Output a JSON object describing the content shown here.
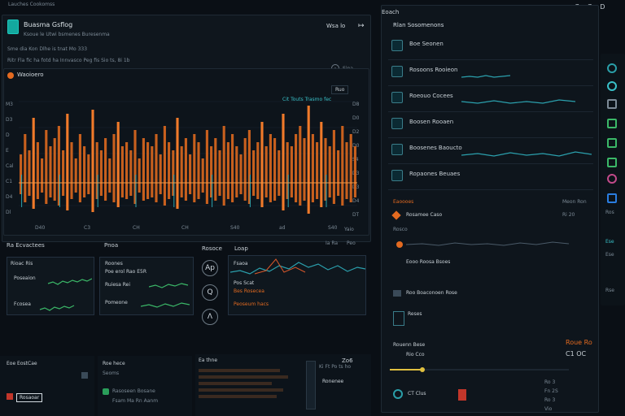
{
  "topbar": {
    "left": "Lauches Cookomss",
    "right_ctrl_a": "C",
    "right_ctrl_b": "C",
    "right_ctrl_c": "D"
  },
  "left_panel": {
    "app_title": "Buasma Gsflog",
    "app_sub": "Ksoue le Utwi bsmenes Buresenma",
    "sub_row_1": "Sme dia Kon Dlhe is tnat Mo 333",
    "sub_row_2": "Ritr Fla fic ha fotd ha Innvasco Peg fis Sio ts, 8i 1b",
    "header_right": "Wsa lo",
    "header_arrow": "↦",
    "header_menu_label": "Sina"
  },
  "waveform_panel": {
    "title": "Waoioero",
    "overlay_label": "Cit Touts Trasmo fec",
    "range_label": "Ruo",
    "x_labels": [
      "D40",
      "C3",
      "CH",
      "CH",
      "S40",
      "ad",
      "S40"
    ],
    "y_labels": [
      "M3",
      "D3",
      "D",
      "E",
      "Cal",
      "C1",
      "D4",
      "Dl"
    ],
    "right_labels": [
      "D8",
      "D0",
      "D2",
      "D0",
      "S4",
      "D3",
      "D3",
      "D4",
      "DT"
    ],
    "bottom_right": "Yaio"
  },
  "bottom_left": {
    "section_label": "Ra Ecvactees",
    "section_label_2": "Pnoa",
    "card1_title": "Rioac Ris",
    "card1_line": "Poseaion",
    "card1_line2": "Fcosea",
    "card2_title": "Roones",
    "card2_line": "Poe erol Rao E5R",
    "card2_line2": "Ruiesa Rei",
    "card2_line3": "Pomeone"
  },
  "bottom_mid": {
    "section_label": "Rosoce",
    "section_label_2": "Loap",
    "nav_a": "Ap",
    "nav_b": "Q",
    "nav_c": "Λ",
    "lines": [
      "Fsaoa",
      "Pos Scat",
      "Bes Rosecea",
      "Peoseum hacs"
    ],
    "corner": "Ia Ra",
    "corner2": "Peo"
  },
  "footer_left": {
    "title": "Eoe EostCae",
    "title_2": "Roe hece",
    "title_3": "Ea thne",
    "items": [
      "Rosaoar",
      "Seoms",
      "Rasoseen Bosane",
      "Fsam Ma Rn Aanm"
    ],
    "meta": "Ki Ft Po ts ho",
    "status": "Zo6",
    "status2": "Ronenee"
  },
  "right_panel": {
    "head": "Eoach",
    "title": "Rlan Sosomenons",
    "rows": [
      {
        "label": "Boe Seonen"
      },
      {
        "label": "Rosoons Rooieon"
      },
      {
        "label": "Roeouo Cocees"
      },
      {
        "label": "Boosen Rooaen"
      },
      {
        "label": "Boosenes Baoucto"
      },
      {
        "label": "Ropaones Beuaes"
      }
    ],
    "section_a": "Eaoooes",
    "section_a_right": "Meon Ron",
    "section_b": "Rosamee Caso",
    "section_b_right": "Ri 20",
    "section_c": "Rosco",
    "section_c_item": "Eooo Roosa Bsoes",
    "section_d": "Roo Boaconoen Rose",
    "section_e": "Reses",
    "section_f": "Rouenn Bese",
    "section_f_right": "Rio Cco",
    "footer_a": "Roue Ro",
    "footer_b": "C1 OC",
    "footer_c": "CT Clus",
    "nums": [
      "Ro 3",
      "Fn 2S",
      "Ro 3",
      "Vio"
    ]
  },
  "sidebar": {
    "labels": [
      "Ros",
      "Ese",
      "Ese",
      "Rse"
    ]
  },
  "colors": {
    "accent": "#e36a20",
    "teal": "#39c0c8",
    "panel": "#121a22",
    "bg": "#0a0f15"
  },
  "chart_data": {
    "type": "bar",
    "title": "Waoioero",
    "x_tick_labels": [
      "D40",
      "C3",
      "CH",
      "CH",
      "S40",
      "ad",
      "S40"
    ],
    "values": [
      0.35,
      0.6,
      0.4,
      0.8,
      0.5,
      0.3,
      0.65,
      0.45,
      0.55,
      0.7,
      0.4,
      0.85,
      0.5,
      0.3,
      0.6,
      0.45,
      0.35,
      0.9,
      0.5,
      0.4,
      0.55,
      0.3,
      0.6,
      0.75,
      0.45,
      0.5,
      0.4,
      0.65,
      0.3,
      0.55,
      0.5,
      0.45,
      0.6,
      0.35,
      0.7,
      0.5,
      0.4,
      0.8,
      0.45,
      0.55,
      0.35,
      0.6,
      0.5,
      0.3,
      0.65,
      0.45,
      0.55,
      0.4,
      0.7,
      0.5,
      0.6,
      0.45,
      0.35,
      0.55,
      0.65,
      0.4,
      0.5,
      0.75,
      0.45,
      0.6,
      0.55,
      0.4,
      0.85,
      0.5,
      0.45,
      0.6,
      0.7,
      0.55,
      0.95,
      0.6,
      0.5,
      0.75,
      0.55,
      0.45,
      0.65,
      0.4,
      0.7,
      0.5,
      0.6,
      0.45
    ],
    "ylim": [
      0,
      1
    ],
    "grid": true
  }
}
